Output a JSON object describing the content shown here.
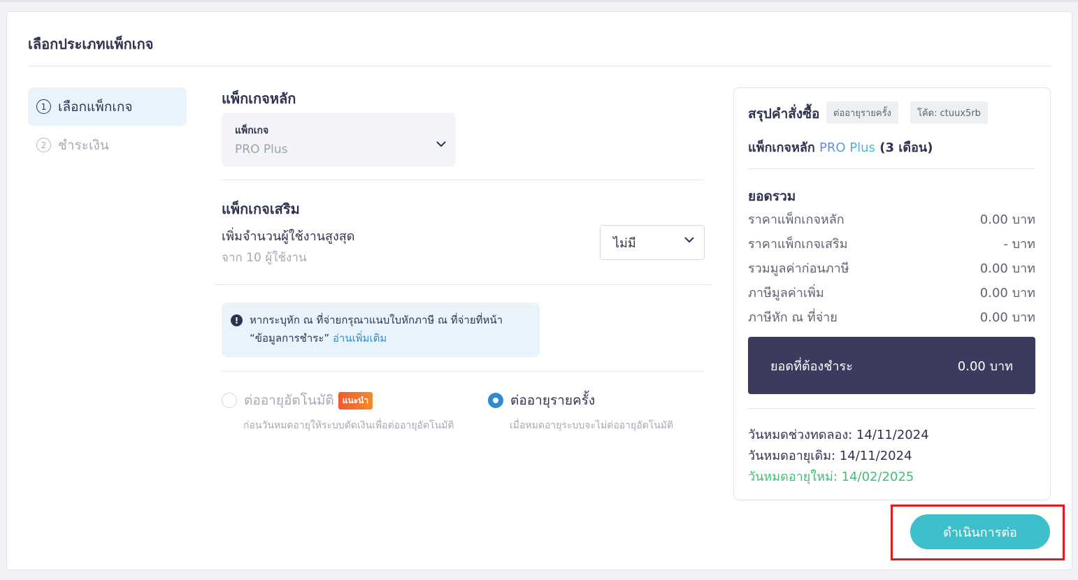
{
  "page": {
    "title": "เลือกประเภทแพ็กเกจ"
  },
  "steps": [
    {
      "num": "1",
      "label": "เลือกแพ็กเกจ"
    },
    {
      "num": "2",
      "label": "ชำระเงิน"
    }
  ],
  "main_package": {
    "heading": "แพ็กเกจหลัก",
    "label": "แพ็กเกจ",
    "value": "PRO Plus"
  },
  "addon": {
    "heading": "แพ็กเกจเสริม",
    "description": "เพิ่มจำนวนผู้ใช้งานสูงสุด",
    "sub": "จาก 10 ผู้ใช้งาน",
    "selected": "ไม่มี"
  },
  "notice": {
    "text": "หากระบุหัก ณ ที่จ่ายกรุณาแนบใบหักภาษี ณ ที่จ่ายที่หน้า “ข้อมูลการชำระ”",
    "link": "อ่านเพิ่มเติม"
  },
  "renewal": {
    "auto_label": "ต่ออายุอัตโนมัติ",
    "auto_badge": "แนะนำ",
    "auto_sub": "ก่อนวันหมดอายุให้ระบบตัดเงินเพื่อต่ออายุอัตโนมัติ",
    "once_label": "ต่ออายุรายครั้ง",
    "once_sub": "เมื่อหมดอายุระบบจะไม่ต่ออายุอัตโนมัติ",
    "selected": "once"
  },
  "summary": {
    "title": "สรุปคำสั่งซื้อ",
    "tag_type": "ต่ออายุรายครั้ง",
    "tag_code": "โค้ด: ctuux5rb",
    "pkg_prefix": "แพ็กเกจหลัก",
    "pkg_name": "PRO Plus",
    "pkg_duration": "(3 เดือน)",
    "total_heading": "ยอดรวม",
    "lines": [
      {
        "label": "ราคาแพ็กเกจหลัก",
        "amount": "0.00  บาท"
      },
      {
        "label": "ราคาแพ็กเกจเสริม",
        "amount": "-  บาท"
      },
      {
        "label": "รวมมูลค่าก่อนภาษี",
        "amount": "0.00  บาท"
      },
      {
        "label": "ภาษีมูลค่าเพิ่ม",
        "amount": "0.00  บาท"
      },
      {
        "label": "ภาษีหัก ณ ที่จ่าย",
        "amount": "0.00  บาท"
      }
    ],
    "due_label": "ยอดที่ต้องชำระ",
    "due_amount": "0.00 บาท",
    "dates": [
      "วันหมดช่วงทดลอง: 14/11/2024",
      "วันหมดอายุเดิม: 14/11/2024",
      "วันหมดอายุใหม่: 14/02/2025"
    ]
  },
  "actions": {
    "continue": "ดำเนินการต่อ"
  },
  "colors": {
    "accent": "#3ec0cc",
    "highlight": "#e8151f",
    "dark": "#3a3b5e",
    "green": "#3fbf73",
    "blue": "#2e8bd1"
  }
}
